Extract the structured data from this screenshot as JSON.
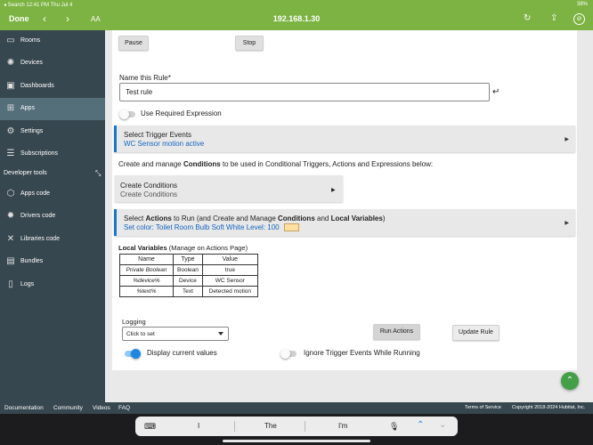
{
  "status_bar": {
    "left": "◂ Search  12:41 PM  Thu Jul 4",
    "right": "38%"
  },
  "toolbar": {
    "done_label": "Done",
    "aa_label": "AA",
    "url": "192.168.1.30"
  },
  "sidebar": {
    "items": [
      {
        "label": "Rooms",
        "icon": "rooms-icon"
      },
      {
        "label": "Devices",
        "icon": "bulb-icon"
      },
      {
        "label": "Dashboards",
        "icon": "dashboard-icon"
      },
      {
        "label": "Apps",
        "icon": "apps-icon",
        "active": true
      },
      {
        "label": "Settings",
        "icon": "settings-icon"
      },
      {
        "label": "Subscriptions",
        "icon": "subscriptions-icon"
      }
    ],
    "developer_tools_label": "Developer tools",
    "dev_items": [
      {
        "label": "Apps code",
        "icon": "apps-code-icon"
      },
      {
        "label": "Drivers code",
        "icon": "drivers-code-icon"
      },
      {
        "label": "Libraries code",
        "icon": "libraries-code-icon"
      },
      {
        "label": "Bundles",
        "icon": "bundles-icon"
      },
      {
        "label": "Logs",
        "icon": "logs-icon"
      }
    ]
  },
  "main": {
    "pause_label": "Pause",
    "stop_label": "Stop",
    "rule_name_label": "Name this Rule*",
    "rule_name_value": "Test rule",
    "required_expression_label": "Use Required Expression",
    "trigger": {
      "title": "Select Trigger Events",
      "subtitle": "WC Sensor motion active"
    },
    "conditions_intro": {
      "pre": "Create and manage ",
      "bold": "Conditions",
      "post": " to be used in Conditional Triggers, Actions and Expressions below:"
    },
    "create_conditions": {
      "title": "Create Conditions",
      "subtitle": "Create Conditions"
    },
    "actions": {
      "t1": "Select ",
      "b1": "Actions",
      "t2": " to Run (and Create and Manage ",
      "b2": "Conditions",
      "t3": " and ",
      "b3": "Local Variables",
      "t4": ")",
      "subtitle": "Set color: Toilet Room Bulb  Soft White  Level: 100"
    },
    "local_vars": {
      "title_bold": "Local Variables",
      "title_rest": " (Manage on Actions Page)",
      "headers": [
        "Name",
        "Type",
        "Value"
      ],
      "rows": [
        [
          "Private Boolean",
          "Boolean",
          "true"
        ],
        [
          "%device%",
          "Device",
          "WC Sensor"
        ],
        [
          "%text%",
          "Text",
          "Detected motion"
        ]
      ]
    },
    "logging_label": "Logging",
    "logging_placeholder": "Click to set",
    "run_actions_label": "Run Actions",
    "update_rule_label": "Update Rule",
    "display_current_values_label": "Display current values",
    "ignore_trigger_label": "Ignore Trigger Events While Running"
  },
  "footer": {
    "links": [
      "Documentation",
      "Community",
      "Videos",
      "FAQ"
    ],
    "terms": "Terms of Service",
    "copyright": "Copyright 2018-2024 Hubitat, Inc."
  },
  "keyboard": {
    "suggestions": [
      "I",
      "The",
      "I'm"
    ]
  },
  "colors": {
    "accent_green": "#7cb342",
    "sidebar": "#37474f",
    "link_blue": "#1565c0",
    "toggle_blue": "#1e88e5"
  }
}
